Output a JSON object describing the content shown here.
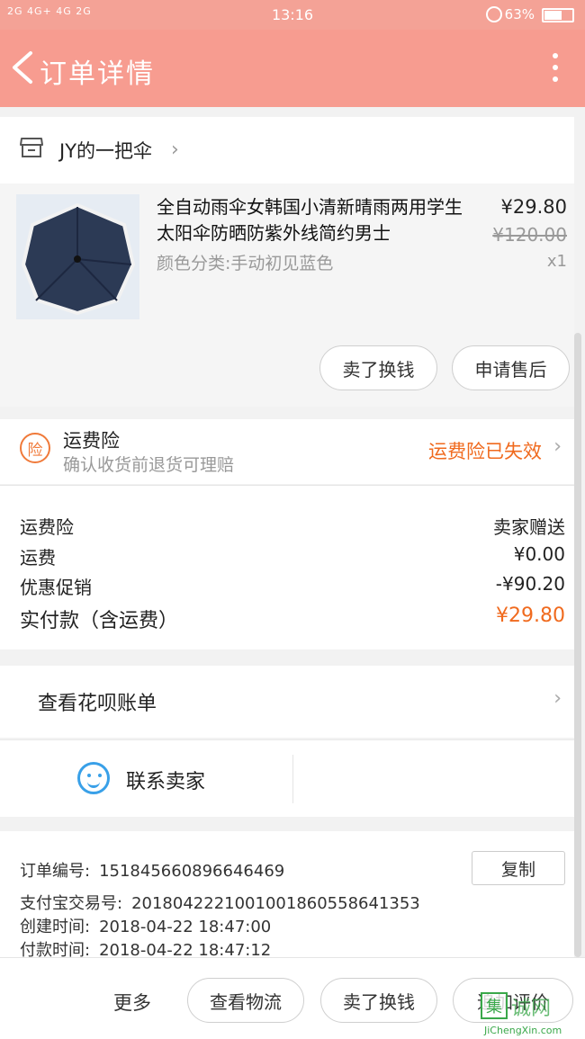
{
  "status_bar": {
    "signal": "2G 4G+ 4G 2G",
    "time": "13:16",
    "battery_pct_text": "63%",
    "battery_level": 0.63
  },
  "nav": {
    "title": "订单详情"
  },
  "shop": {
    "name": "JY的一把伞",
    "chevron": "›"
  },
  "item": {
    "title": "全自动雨伞女韩国小清新晴雨两用学生太阳伞防晒防紫外线简约男士",
    "sku": "颜色分类:手动初见蓝色",
    "price": "¥29.80",
    "original_price": "¥120.00",
    "quantity": "x1",
    "sell_button": "卖了换钱",
    "after_sale_button": "申请售后"
  },
  "insurance": {
    "badge": "险",
    "title": "运费险",
    "subtitle": "确认收货前退货可理赔",
    "status": "运费险已失效",
    "chevron": "›"
  },
  "fees": [
    {
      "label": "运费险",
      "value": "卖家赠送"
    },
    {
      "label": "运费",
      "value": "¥0.00"
    },
    {
      "label": "优惠促销",
      "value": "-¥90.20"
    },
    {
      "label": "实付款（含运费）",
      "value": "¥29.80"
    }
  ],
  "huabei": {
    "label": "查看花呗账单",
    "chevron": "›"
  },
  "contact": {
    "label": "联系卖家"
  },
  "order_info": {
    "order_no_label": "订单编号:",
    "order_no": "151845660896646469",
    "copy_button": "复制",
    "alipay_label": "支付宝交易号:",
    "alipay_no": "2018042221001001860558641353",
    "created_label": "创建时间:",
    "created": "2018-04-22 18:47:00",
    "paid_label": "付款时间:",
    "paid": "2018-04-22 18:47:12"
  },
  "bottom_bar": {
    "more": "更多",
    "logistics": "查看物流",
    "sell": "卖了换钱",
    "review": "追加评价"
  },
  "watermark": {
    "box": "集",
    "cn": "诚网",
    "en": "JiChengXin.com"
  },
  "colors": {
    "nav_bg": "#f79c90",
    "accent_orange": "#f06a1e",
    "contact_blue": "#39a0e8"
  },
  "icons": [
    "back-arrow-icon",
    "more-vertical-icon",
    "store-icon",
    "chevron-right-icon",
    "insurance-badge-icon",
    "chat-smile-icon",
    "lock-rotation-icon",
    "battery-icon"
  ]
}
